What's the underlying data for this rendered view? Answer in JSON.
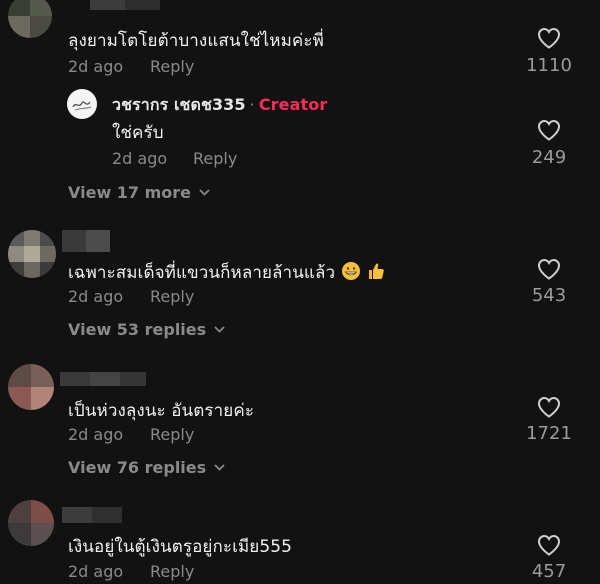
{
  "colors": {
    "background": "#121212",
    "creator_tag": "#fe2c55",
    "muted": "#8a8a8a"
  },
  "comments": [
    {
      "text": "ลุงยามโตโยต้าบางแสนใช่ไหมค่ะพี่",
      "age": "2d ago",
      "reply_label": "Reply",
      "likes": "1110"
    },
    {
      "text": "เฉพาะสมเด็จที่แขวนก็หลายล้านแล้ว",
      "age": "2d ago",
      "reply_label": "Reply",
      "likes": "543",
      "view_replies": "View 53 replies"
    },
    {
      "text": "เป็นห่วงลุงนะ อันตรายค่ะ",
      "age": "2d ago",
      "reply_label": "Reply",
      "likes": "1721",
      "view_replies": "View 76 replies"
    },
    {
      "text": "เงินอยู่ในตู้เงินตรูอยู่กะเมีย555",
      "age": "2d ago",
      "reply_label": "Reply",
      "likes": "457"
    }
  ],
  "creator_reply": {
    "username": "วชรากร เชดช335",
    "separator": "·",
    "tag": "Creator",
    "text": "ใช่ครับ",
    "age": "2d ago",
    "reply_label": "Reply",
    "likes": "249"
  },
  "view_more_1": "View 17 more",
  "icons": {
    "like": "heart-outline-icon",
    "expand": "chevron-down-icon",
    "emoji_grin": "grinning-face-icon",
    "emoji_thumb": "thumbs-up-icon"
  }
}
